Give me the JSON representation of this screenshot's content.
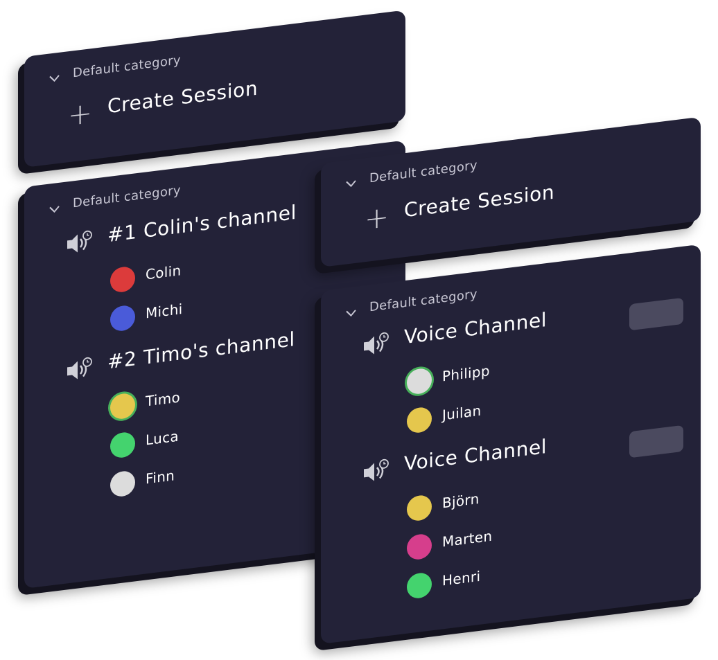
{
  "colors": {
    "panel_bg": "#232238",
    "panel_edge": "#14131f",
    "category_text": "#c7c6d3",
    "icon_gray": "#d0d0d8",
    "speaking_ring": "#47b05a",
    "badge_bg": "#4b4a5f"
  },
  "panel_top_left": {
    "category_label": "Default category",
    "chevron_icon": "chevron-down-icon",
    "add_icon": "plus-icon",
    "create_label": "Create Session"
  },
  "panel_channels_left": {
    "category_label": "Default category",
    "channels": [
      {
        "name": "#1 Colin's channel",
        "icon": "voice-channel-timer-icon",
        "members": [
          {
            "name": "Colin",
            "color": "#dc3b3b",
            "speaking": false
          },
          {
            "name": "Michi",
            "color": "#4a5bd9",
            "speaking": false
          }
        ]
      },
      {
        "name": "#2 Timo's channel",
        "icon": "voice-channel-timer-icon",
        "members": [
          {
            "name": "Timo",
            "color": "#e5c74d",
            "speaking": true
          },
          {
            "name": "Luca",
            "color": "#44d36e",
            "speaking": false
          },
          {
            "name": "Finn",
            "color": "#dcdcdc",
            "speaking": false
          }
        ]
      }
    ]
  },
  "panel_top_right": {
    "category_label": "Default category",
    "chevron_icon": "chevron-down-icon",
    "add_icon": "plus-icon",
    "create_label": "Create Session"
  },
  "panel_channels_right": {
    "category_label": "Default category",
    "channels": [
      {
        "name": "Voice Channel",
        "icon": "voice-channel-timer-icon",
        "members": [
          {
            "name": "Philipp",
            "color": "#dcdcdc",
            "speaking": true
          },
          {
            "name": "Juilan",
            "color": "#e5c74d",
            "speaking": false
          }
        ]
      },
      {
        "name": "Voice Channel",
        "icon": "voice-channel-timer-icon",
        "members": [
          {
            "name": "Björn",
            "color": "#e5c74d",
            "speaking": false
          },
          {
            "name": "Marten",
            "color": "#d63e8c",
            "speaking": false
          },
          {
            "name": "Henri",
            "color": "#44d36e",
            "speaking": false
          }
        ]
      }
    ]
  }
}
